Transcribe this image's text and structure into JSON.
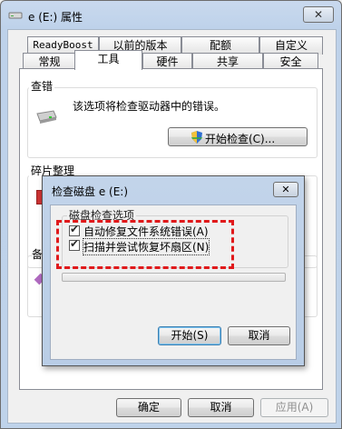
{
  "window": {
    "title": "e (E:) 属性",
    "close_glyph": "✕"
  },
  "tabs_row1": [
    "ReadyBoost",
    "以前的版本",
    "配额",
    "自定义"
  ],
  "tabs_row2": [
    "常规",
    "工具",
    "硬件",
    "共享",
    "安全"
  ],
  "active_tab": "工具",
  "error_check": {
    "label": "查错",
    "description": "该选项将检查驱动器中的错误。",
    "button": "开始检查(C)..."
  },
  "defrag": {
    "label": "碎片整理",
    "label_partial": "备"
  },
  "dialog": {
    "title": "检查磁盘 e (E:)",
    "close_glyph": "✕",
    "group_label": "磁盘检查选项",
    "options": [
      {
        "label": "自动修复文件系统错误(A)",
        "checked": true
      },
      {
        "label": "扫描并尝试恢复坏扇区(N)",
        "checked": true
      }
    ],
    "start_button": "开始(S)",
    "cancel_button": "取消"
  },
  "footer": {
    "ok": "确定",
    "cancel": "取消",
    "apply": "应用(A)"
  },
  "colors": {
    "highlight": "#e0191b",
    "title_bar": "#c9d9ee"
  }
}
